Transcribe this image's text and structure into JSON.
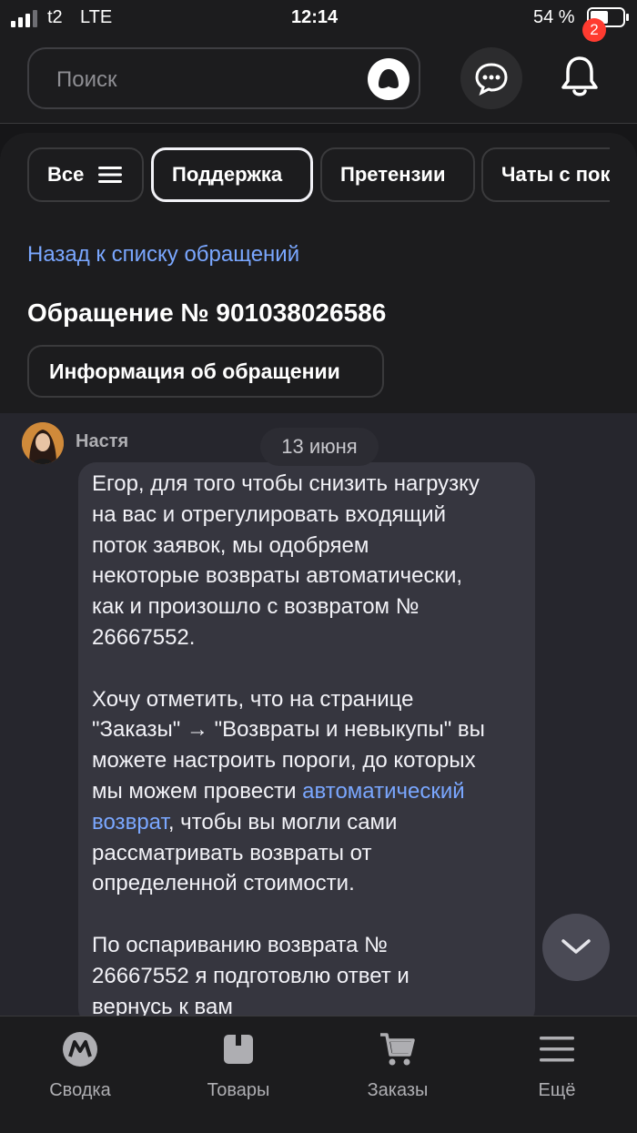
{
  "status_bar": {
    "carrier": "t2",
    "network": "LTE",
    "time": "12:14",
    "battery_percent": "54 %",
    "battery_level": 0.54
  },
  "header": {
    "search_placeholder": "Поиск",
    "notifications_count": "2",
    "icons": {
      "alice": "alice-icon",
      "chat": "chat-bubble-icon",
      "notifications": "bell-icon"
    }
  },
  "tabs": [
    {
      "label": "Все",
      "active": false,
      "icon": "menu-icon"
    },
    {
      "label": "Поддержка",
      "active": true
    },
    {
      "label": "Претензии",
      "active": false
    },
    {
      "label": "Чаты с пок",
      "active": false
    }
  ],
  "back_link": "Назад к списку обращений",
  "ticket_title": "Обращение № 901038026586",
  "info_button": "Информация об обращении",
  "chat": {
    "sender": "Настя",
    "date": "13 июня",
    "message_part1": "Егор, для того чтобы снизить нагрузку\nна вас и отрегулировать входящий\nпоток заявок, мы одобряем\nнекоторые возвраты автоматически,\nкак и произошло с возвратом №\n26667552.\n\nХочу отметить, что на странице\n\"Заказы\" → \"Возвраты и невыкупы\" вы\nможете настроить пороги, до которых\nмы можем провести ",
    "message_link": "автоматический\nвозврат",
    "message_part2": ", чтобы вы могли сами\nрассматривать возвраты от\nопределенной стоимости.\n\nПо оспариванию возврата №\n26667552 я подготовлю ответ и\nвернусь к вам"
  },
  "bottom_nav": [
    {
      "label": "Сводка",
      "icon": "market-logo-icon"
    },
    {
      "label": "Товары",
      "icon": "box-icon"
    },
    {
      "label": "Заказы",
      "icon": "cart-icon"
    },
    {
      "label": "Ещё",
      "icon": "hamburger-icon"
    }
  ],
  "colors": {
    "background": "#1c1c1e",
    "chat_background": "#26262d",
    "bubble": "#36363f",
    "link": "#7aa7ff",
    "badge": "#ff3b30"
  }
}
